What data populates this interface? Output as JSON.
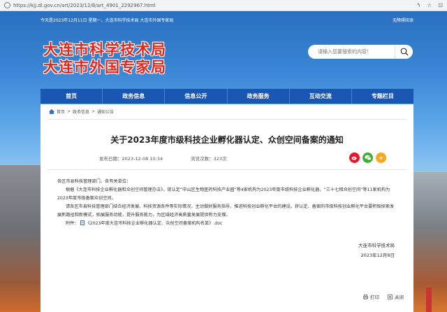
{
  "browser": {
    "url": "https://kjj.dl.gov.cn/art/2023/12/8/art_4901_2292967.html"
  },
  "topbar": {
    "date_text": "今天是2023年12月11日 星期一，大连市科学技术局 大连市外国专家局",
    "accessibility": "无障碍阅读"
  },
  "header": {
    "title_line1": "大连市科学技术局",
    "title_line2": "大连市外国专家局",
    "search_placeholder": "请输入您要搜索的内容！"
  },
  "nav": {
    "items": [
      "首页",
      "政务信息",
      "信息公开",
      "政务服务",
      "互动交流",
      "专题栏目"
    ]
  },
  "breadcrumb": {
    "home": "首页",
    "sep1": ">",
    "section": "政务信息",
    "sep2": ">",
    "current": "通知公告"
  },
  "article": {
    "title": "关于2023年度市级科技企业孵化器认定、众创空间备案的通知",
    "publish_time": "发布日期：2023-12-08  10:34",
    "views": "浏览次数：323次",
    "salutation": "各区市县科技管理部门、各有关单位：",
    "para1": "根据《大连市科技企业孵化器和众创空间管理办法》，现认定“中山区生物医药科技产业园”等4家机构为2023年度市级科技企业孵化器，“三十七相众创空间”等11家机构为2023年度市级备案众创空间。",
    "para2": "请各区市县科技管理部门结合经济发展、科技资源条件等实际情况，主动做好服务指导，推进科技创业孵化平台的建设。获认定、备案的市级科技创业孵化平台要积极探索发展新路径和新模式，拓展服务功能，提升服务能力，为区域经济高质量发展提供有力支撑。",
    "attachment_label": "附件：",
    "attachment_name": "《2023年度大连市科技企业孵化器认定、众创空间备案机构名单》.doc",
    "signature": "大连市科学技术局",
    "sign_date": "2023年12月8日"
  },
  "tools": {
    "print": "打印",
    "close": "关闭"
  },
  "colors": {
    "nav_blue": "#1a57b3",
    "title_red": "#e0281f",
    "weibo": "#e6162d",
    "wechat": "#3cb034",
    "star": "#f5a623"
  },
  "icons": {
    "share": [
      "weibo-icon",
      "wechat-icon",
      "favorite-icon"
    ]
  }
}
